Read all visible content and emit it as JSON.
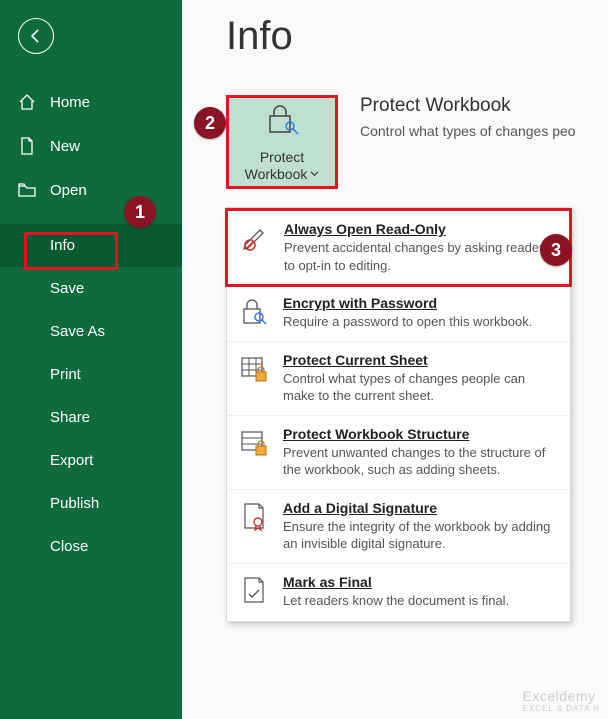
{
  "sidebar": {
    "items": [
      {
        "label": "Home",
        "icon": "home"
      },
      {
        "label": "New",
        "icon": "new"
      },
      {
        "label": "Open",
        "icon": "open"
      },
      {
        "label": "Info",
        "icon": null,
        "selected": true
      },
      {
        "label": "Save",
        "icon": null
      },
      {
        "label": "Save As",
        "icon": null
      },
      {
        "label": "Print",
        "icon": null
      },
      {
        "label": "Share",
        "icon": null
      },
      {
        "label": "Export",
        "icon": null
      },
      {
        "label": "Publish",
        "icon": null
      },
      {
        "label": "Close",
        "icon": null
      }
    ]
  },
  "main": {
    "title": "Info",
    "protect_btn_line1": "Protect",
    "protect_btn_line2": "Workbook",
    "protect_heading": "Protect Workbook",
    "protect_desc": "Control what types of changes peo"
  },
  "menu": {
    "items": [
      {
        "title": "Always Open Read-Only",
        "desc": "Prevent accidental changes by asking readers to opt-in to editing."
      },
      {
        "title": "Encrypt with Password",
        "desc": "Require a password to open this workbook."
      },
      {
        "title": "Protect Current Sheet",
        "desc": "Control what types of changes people can make to the current sheet."
      },
      {
        "title": "Protect Workbook Structure",
        "desc": "Prevent unwanted changes to the structure of the workbook, such as adding sheets."
      },
      {
        "title": "Add a Digital Signature",
        "desc": "Ensure the integrity of the workbook by adding an invisible digital signature."
      },
      {
        "title": "Mark as Final",
        "desc": "Let readers know the document is final."
      }
    ]
  },
  "callouts": {
    "b1": "1",
    "b2": "2",
    "b3": "3"
  },
  "watermark": {
    "brand": "Exceldemy",
    "tag": "EXCEL & DATA H"
  }
}
